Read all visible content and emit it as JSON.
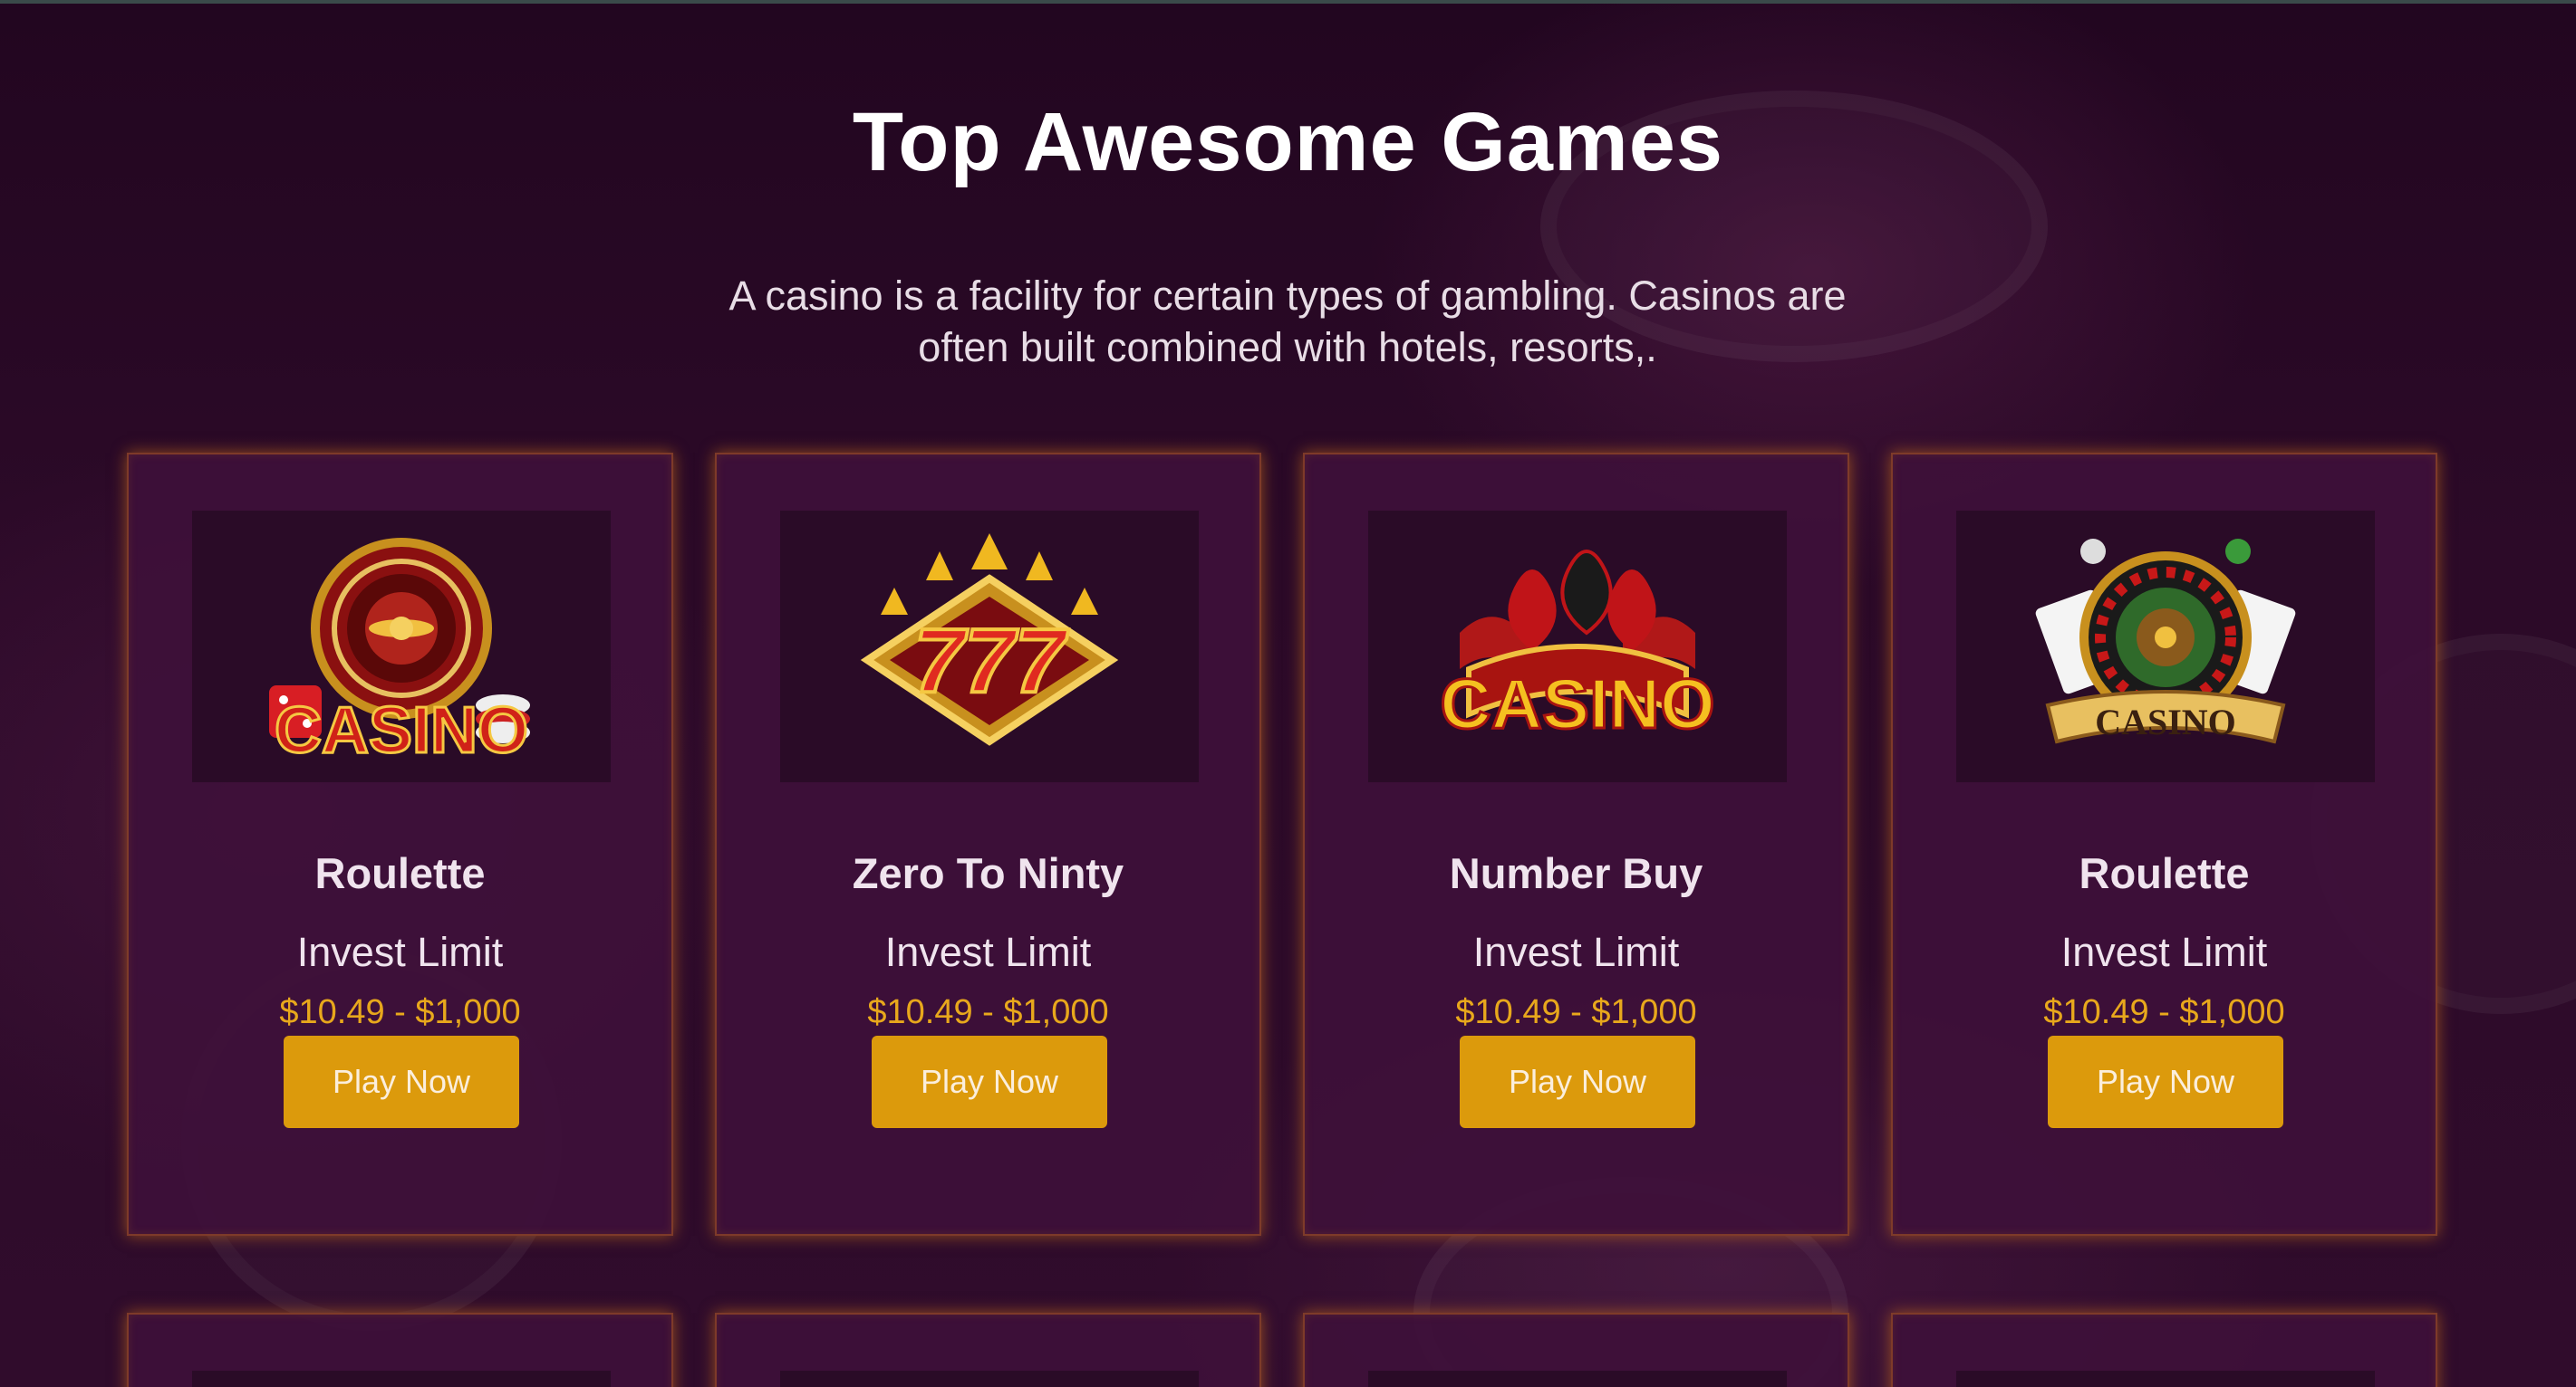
{
  "section": {
    "title": "Top Awesome Games",
    "description": "A casino is a facility for certain types of gambling. Casinos are often built combined with hotels, resorts,."
  },
  "games": [
    {
      "title": "Roulette",
      "limit_label": "Invest Limit",
      "limit_range": "$10.49 - $1,000",
      "button_label": "Play Now",
      "logo_text": "CASINO",
      "icon": "roulette-casino-logo-icon"
    },
    {
      "title": "Zero To Ninty",
      "limit_label": "Invest Limit",
      "limit_range": "$10.49 - $1,000",
      "button_label": "Play Now",
      "logo_text": "777",
      "icon": "lucky-777-logo-icon"
    },
    {
      "title": "Number Buy",
      "limit_label": "Invest Limit",
      "limit_range": "$10.49 - $1,000",
      "button_label": "Play Now",
      "logo_text": "CASINO",
      "icon": "card-suits-casino-logo-icon"
    },
    {
      "title": "Roulette",
      "limit_label": "Invest Limit",
      "limit_range": "$10.49 - $1,000",
      "button_label": "Play Now",
      "logo_text": "CASINO",
      "icon": "roulette-cards-casino-logo-icon"
    }
  ],
  "colors": {
    "background": "#2a0a26",
    "card": "#3e103a",
    "accent": "#dc9a0c",
    "price": "#e8a81c",
    "glow": "#e68214"
  }
}
